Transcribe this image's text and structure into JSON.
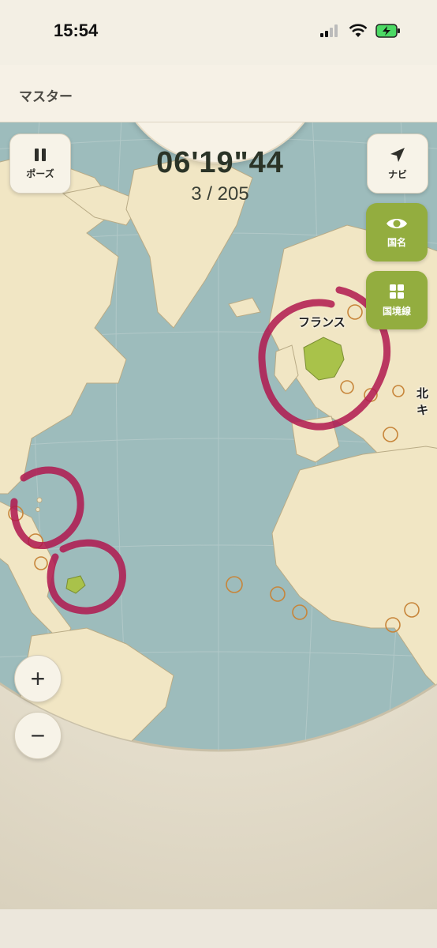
{
  "status": {
    "time": "15:54"
  },
  "header": {
    "title": "マスター"
  },
  "timer": {
    "elapsed": "06'19\"44",
    "progress": "3 / 205"
  },
  "controls": {
    "pause_label": "ポーズ",
    "navi_label": "ナビ",
    "country_names_label": "国名",
    "borders_label": "国境線",
    "zoom_in": "+",
    "zoom_out": "−"
  },
  "map": {
    "labels": {
      "france": "フランス",
      "north_edge": "北キ"
    },
    "colors": {
      "ocean": "#9dbcbc",
      "land": "#f1e6c4",
      "highlight": "#a9c24a",
      "marker": "#c7853a",
      "annotation": "#b0174f"
    }
  }
}
